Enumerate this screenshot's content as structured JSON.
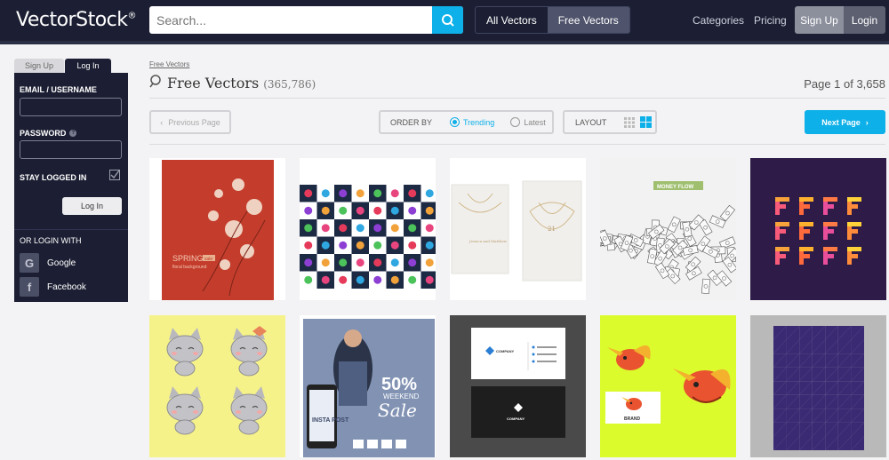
{
  "header": {
    "logo": "VectorStock",
    "logo_mark": "®",
    "search_placeholder": "Search...",
    "filters": [
      "All Vectors",
      "Free Vectors"
    ],
    "categories_label": "Categories",
    "pricing_label": "Pricing",
    "signup_label": "Sign Up",
    "login_label": "Login"
  },
  "sidebar": {
    "tab_signup": "Sign Up",
    "tab_login": "Log In",
    "email_label": "EMAIL / USERNAME",
    "password_label": "PASSWORD",
    "password_hint": "?",
    "stay_logged_in_label": "STAY LOGGED IN",
    "login_button": "Log In",
    "or_login_with": "OR LOGIN WITH",
    "google_label": "Google",
    "google_glyph": "G",
    "facebook_label": "Facebook",
    "facebook_glyph": "f"
  },
  "main": {
    "breadcrumb": "Free Vectors",
    "title": "Free Vectors",
    "count": "(365,786)",
    "page_info": "Page 1 of 3,658",
    "prev_page": "Previous Page",
    "order_by_label": "ORDER BY",
    "order_options": [
      "Trending",
      "Latest"
    ],
    "layout_label": "LAYOUT",
    "next_page": "Next Page"
  },
  "thumbnails": {
    "spring_text": "SPRING",
    "spring_tag": "sale",
    "spring_sub": "floral background",
    "card_text": "Jessica and Matthew",
    "card_date": "21",
    "money_banner": "MONEY FLOW",
    "sale_pct": "50%",
    "sale_weekend": "WEEKEND",
    "sale_word": "Sale",
    "insta_post": "INSTA POST",
    "biz_company": "COMPANY",
    "bird_brand": "BRAND"
  },
  "colors": {
    "nav_bg": "#1c1f33",
    "accent": "#0db0e8"
  }
}
